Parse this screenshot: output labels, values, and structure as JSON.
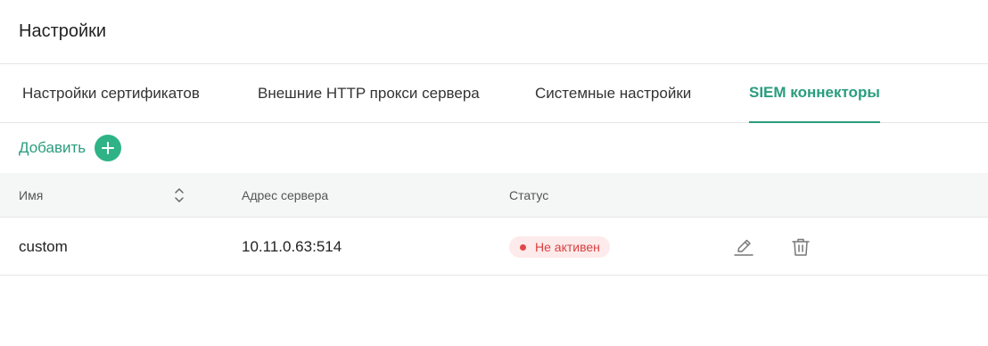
{
  "page": {
    "title": "Настройки"
  },
  "tabs": [
    {
      "label": "Настройки сертификатов",
      "active": false
    },
    {
      "label": "Внешние HTTP прокси сервера",
      "active": false
    },
    {
      "label": "Системные настройки",
      "active": false
    },
    {
      "label": "SIEM коннекторы",
      "active": true
    }
  ],
  "toolbar": {
    "add_label": "Добавить",
    "add_icon": "plus-icon"
  },
  "table": {
    "columns": [
      "Имя",
      "Адрес сервера",
      "Статус"
    ],
    "rows": [
      {
        "name": "custom",
        "address": "10.11.0.63:514",
        "status": "Не активен"
      }
    ]
  },
  "colors": {
    "accent": "#2a9d7e",
    "add_button": "#2fb386",
    "status_inactive_bg": "#fdeaea",
    "status_inactive_text": "#d94040"
  }
}
